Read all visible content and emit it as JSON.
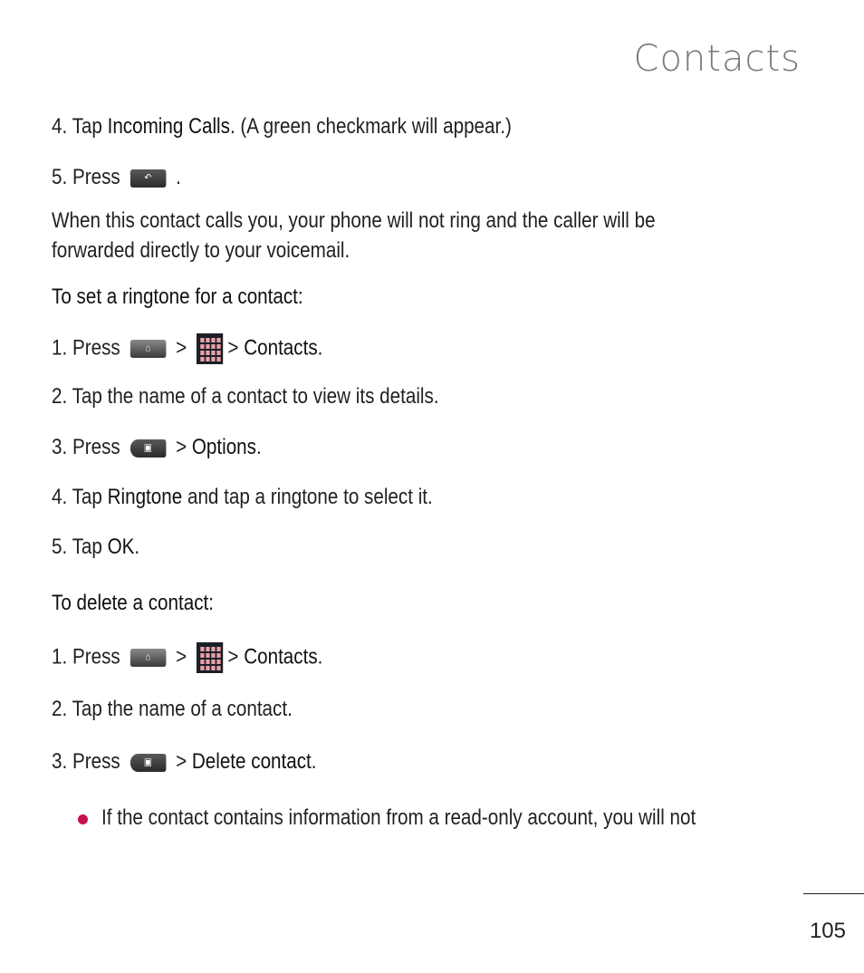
{
  "page_title": "Contacts",
  "lines": {
    "l1_pre": "4. Tap ",
    "l1_bold": "Incoming Calls",
    "l1_post": ". (A green checkmark will appear.)",
    "l2_pre": "5. Press",
    "l2_post": ".",
    "l3": "When this contact calls you, your phone will not ring and the caller will be",
    "l4": "forwarded directly to your voicemail.",
    "h1": "To set a ringtone for a contact:",
    "r1_pre": "1. Press",
    "r1_sep1": ">",
    "r1_sep2": "> ",
    "r1_bold": "Contacts",
    "r1_post": ".",
    "r2": "2. Tap the name of a contact to view its details.",
    "r3_pre": "3. Press",
    "r3_sep": "> ",
    "r3_bold": "Options",
    "r3_post": ".",
    "r4_pre": "4. Tap ",
    "r4_bold": "Ringtone",
    "r4_post": " and tap a ringtone to select it.",
    "r5_pre": "5. Tap ",
    "r5_bold": "OK",
    "r5_post": ".",
    "h2": "To delete a contact:",
    "d1_pre": "1. Press",
    "d1_sep1": ">",
    "d1_sep2": "> ",
    "d1_bold": "Contacts",
    "d1_post": ".",
    "d2": "2. Tap the name of a contact.",
    "d3_pre": "3. Press",
    "d3_sep": "> ",
    "d3_bold": "Delete contact",
    "d3_post": ".",
    "bullet": "If the contact contains information from a read-only account, you will not"
  },
  "icons": {
    "back": "↶",
    "home": "⌂",
    "menu": "▣"
  },
  "page_number": "105",
  "accent_color": "#c8104e"
}
